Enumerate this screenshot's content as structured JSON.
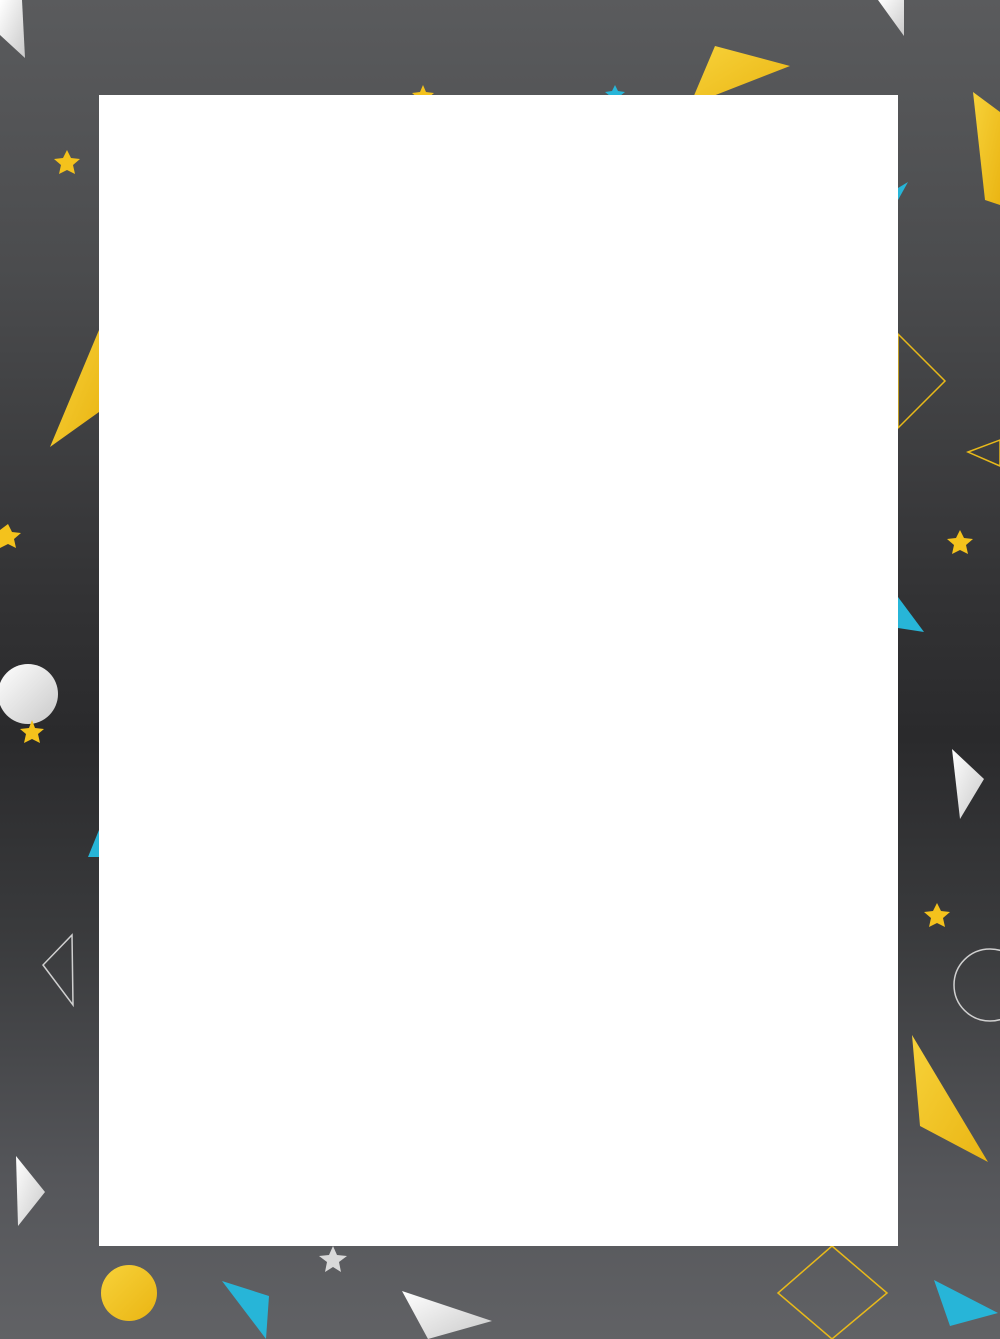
{
  "background": {
    "gradient_colors": [
      "#5a5b5d",
      "#2a2a2c",
      "#616265"
    ]
  },
  "panel": {
    "color": "#ffffff"
  },
  "decor_colors": {
    "yellow": "#f4c21c",
    "cyan": "#27b5d8",
    "white": "#f2f2f2",
    "outline_yellow": "#e8b91a",
    "outline_white": "#d0d0d0"
  },
  "decor_shape_names": [
    "triangle",
    "star",
    "circle",
    "diamond-outline",
    "triangle-outline",
    "circle-outline"
  ]
}
